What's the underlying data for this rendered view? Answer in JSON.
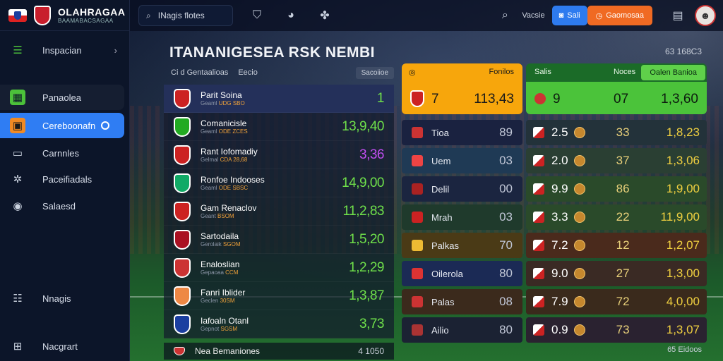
{
  "brand": {
    "name": "OLAHRAGAA",
    "subtitle": "BAAMABACSAGAA"
  },
  "sidebar": {
    "items": [
      {
        "label": "Inspacian",
        "icon": "leaf-icon"
      },
      {
        "label": "Panaolea",
        "icon": "grid-icon"
      },
      {
        "label": "Cereboonafn",
        "icon": "calendar-icon"
      },
      {
        "label": "Carnnles",
        "icon": "folder-icon"
      },
      {
        "label": "Paceifiadals",
        "icon": "settings-icon"
      },
      {
        "label": "Salaesd",
        "icon": "globe-icon"
      },
      {
        "label": "Nnagis",
        "icon": "list-icon"
      },
      {
        "label": "Nacgrart",
        "icon": "grid-icon"
      }
    ]
  },
  "topbar": {
    "search_label": "INagis flotes",
    "right_label": "Vacsie",
    "blue_button": "Sali",
    "orange_button": "Gaomosaa"
  },
  "page": {
    "title": "ITANANIGESEA RSK NEMBI",
    "meta": "63 168C3"
  },
  "left_table": {
    "header_left": "Ci d Gentaalioas",
    "header_mid": "Eecio",
    "sort_label": "Sacoiioe",
    "rows": [
      {
        "name": "Parit Soina",
        "sub_a": "Geaml",
        "sub_b": "UDG",
        "sub_c": "SBO",
        "value": "1"
      },
      {
        "name": "Comanicisle",
        "sub_a": "Geaml",
        "sub_b": "ODE",
        "sub_c": "ZCES",
        "value": "13,9,40"
      },
      {
        "name": "Rant Iofomadiy",
        "sub_a": "Gelmal",
        "sub_b": "CDA",
        "sub_c": "28,68",
        "value": "3,36"
      },
      {
        "name": "Ronfoe Indooses",
        "sub_a": "Geaml",
        "sub_b": "ODE",
        "sub_c": "SBSC",
        "value": "14,9,00"
      },
      {
        "name": "Gam Renaclov",
        "sub_a": "Geant",
        "sub_b": "BSOM",
        "sub_c": "",
        "value": "11,2,83"
      },
      {
        "name": "Sartodaila",
        "sub_a": "Gerolaik",
        "sub_b": "SGOM",
        "sub_c": "",
        "value": "1,5,20"
      },
      {
        "name": "Enaloslian",
        "sub_a": "Gepaoaa",
        "sub_b": "CCM",
        "sub_c": "",
        "value": "1,2,29"
      },
      {
        "name": "Fanri Iblider",
        "sub_a": "Geclen",
        "sub_b": "",
        "sub_c": "30SM",
        "value": "1,3,87"
      },
      {
        "name": "Iafoaln Otanl",
        "sub_a": "Gepnot",
        "sub_b": "",
        "sub_c": "SGSM",
        "value": "3,73"
      }
    ],
    "bottom_name": "Nea Bemaniones",
    "bottom_value": "4 1050"
  },
  "right_grid": {
    "orange_head": {
      "label": "Fonilos",
      "left": "7",
      "right": "113,43"
    },
    "green_head": {
      "label": "Salis",
      "col": "Noces",
      "tab": "Oalen Banioa",
      "left": "9",
      "mid": "07",
      "right": "1,3,60"
    },
    "rows": [
      {
        "label": "Tioa",
        "num": "89",
        "odd": "2.5",
        "mid": "33",
        "val": "1,8,23"
      },
      {
        "label": "Uem",
        "num": "03",
        "odd": "2.0",
        "mid": "37",
        "val": "1,3,06"
      },
      {
        "label": "Delil",
        "num": "00",
        "odd": "9.9",
        "mid": "86",
        "val": "1,9,00"
      },
      {
        "label": "Mrah",
        "num": "03",
        "odd": "3.3",
        "mid": "22",
        "val": "11,9,00"
      },
      {
        "label": "Palkas",
        "num": "70",
        "odd": "7.2",
        "mid": "12",
        "val": "1,2,07"
      },
      {
        "label": "Oilerola",
        "num": "80",
        "odd": "9.0",
        "mid": "27",
        "val": "1,3,00"
      },
      {
        "label": "Palas",
        "num": "08",
        "odd": "7.9",
        "mid": "72",
        "val": "4,0,00"
      },
      {
        "label": "Ailio",
        "num": "80",
        "odd": "0.9",
        "mid": "73",
        "val": "1,3,07"
      }
    ],
    "bottom_meta": "65 Eidoos"
  },
  "colors": {
    "accent_blue": "#2f7df3",
    "accent_orange": "#f06a23",
    "header_yellow": "#f7a60c",
    "header_green": "#4bc33a",
    "value_green": "#6fe04a"
  }
}
